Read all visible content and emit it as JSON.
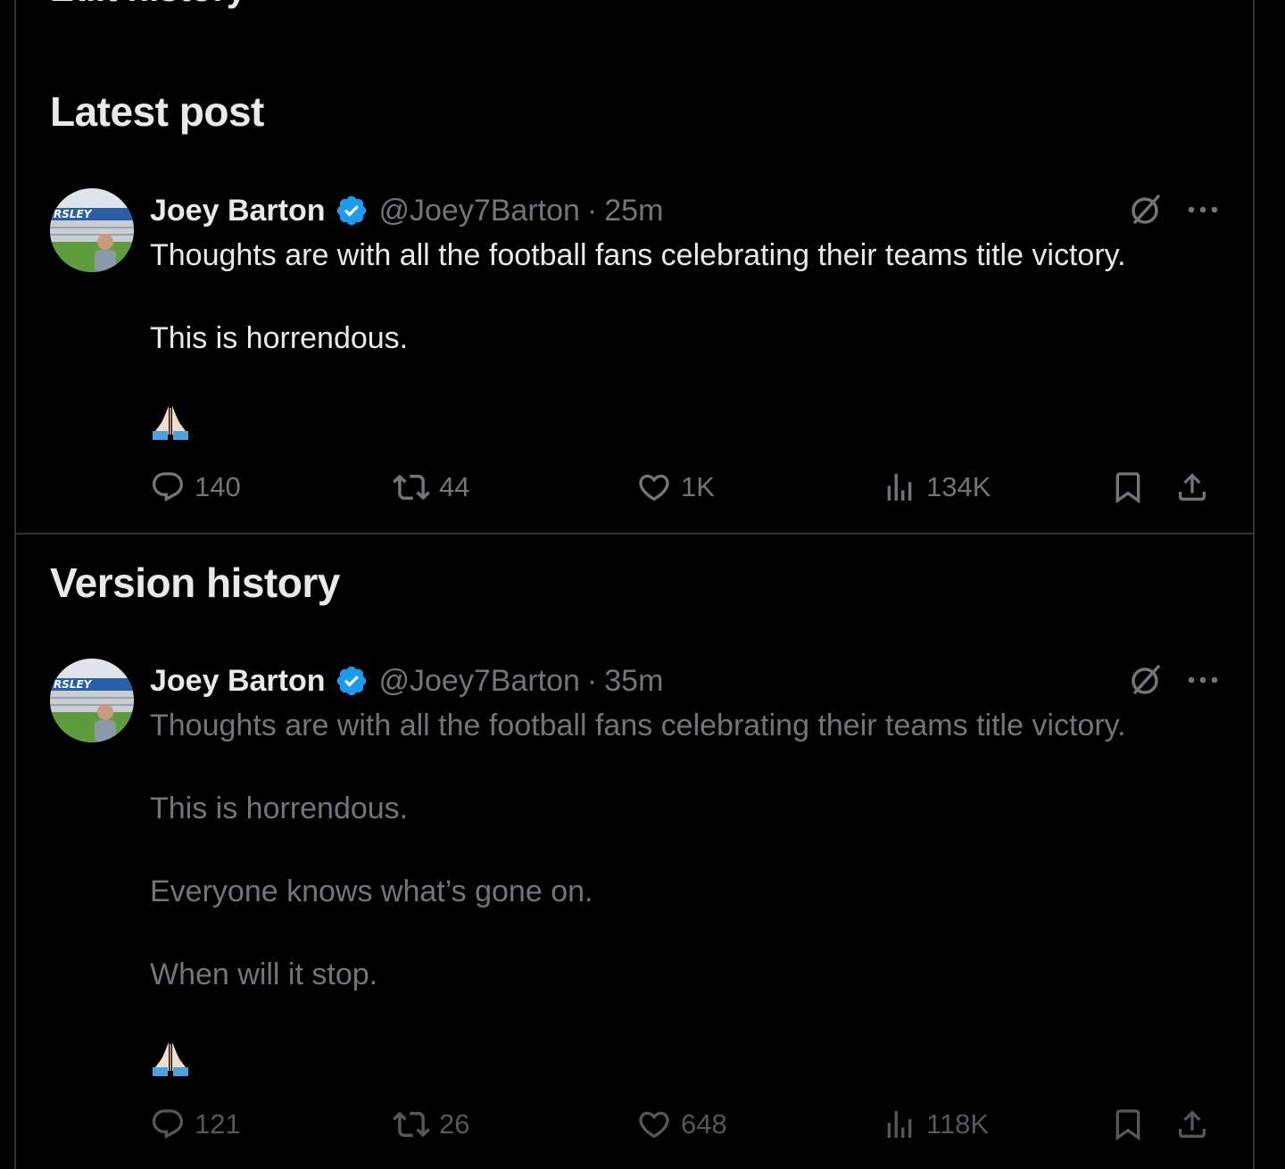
{
  "top_heading_partial": "Edit history",
  "latest": {
    "section_title": "Latest post",
    "name": "Joey Barton",
    "handle": "@Joey7Barton",
    "separator": "·",
    "time": "25m",
    "paragraphs": [
      "Thoughts are with all the football fans celebrating their teams title victory.",
      "This is horrendous."
    ],
    "emoji": "🙏🏻",
    "stats": {
      "replies": "140",
      "reposts": "44",
      "likes": "1K",
      "views": "134K"
    }
  },
  "history": {
    "section_title": "Version history",
    "name": "Joey Barton",
    "handle": "@Joey7Barton",
    "separator": "·",
    "time": "35m",
    "paragraphs": [
      "Thoughts are with all the football fans celebrating their teams title victory.",
      "This is horrendous.",
      "Everyone knows what’s gone on.",
      "When will it stop."
    ],
    "emoji": "🙏🏻",
    "stats": {
      "replies": "121",
      "reposts": "26",
      "likes": "648",
      "views": "118K"
    }
  },
  "colors": {
    "background": "#000000",
    "text_primary": "#e7e9ea",
    "text_secondary": "#71767b",
    "verified_blue": "#1d9bf0",
    "border": "#2f3336"
  },
  "icons": [
    "verified-badge-icon",
    "grok-icon",
    "more-icon",
    "reply-icon",
    "repost-icon",
    "like-icon",
    "views-icon",
    "bookmark-icon",
    "share-icon"
  ]
}
